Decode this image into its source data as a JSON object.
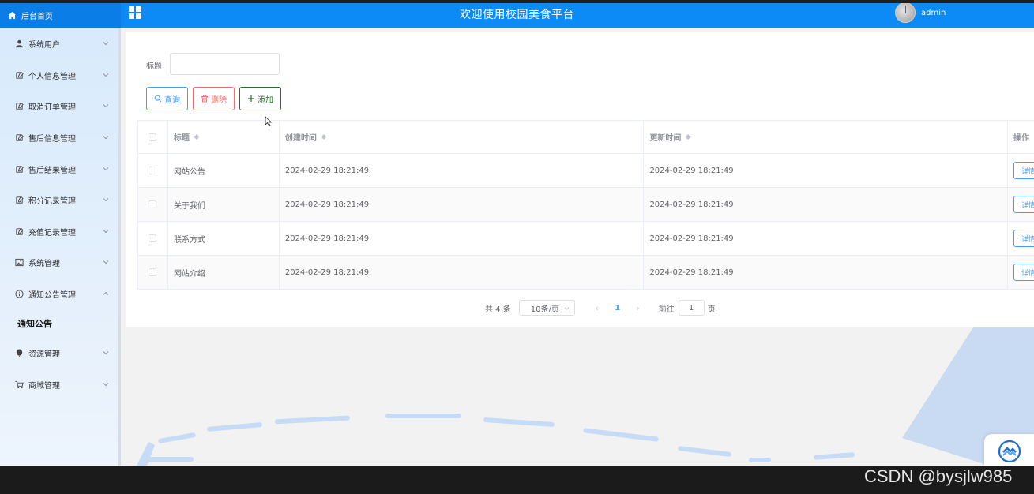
{
  "header": {
    "home_label": "后台首页",
    "title": "欢迎使用校园美食平台",
    "username": "admin"
  },
  "sidebar": {
    "items": [
      {
        "label": "系统用户",
        "icon": "user-icon"
      },
      {
        "label": "个人信息管理",
        "icon": "edit-icon"
      },
      {
        "label": "取消订单管理",
        "icon": "edit-icon"
      },
      {
        "label": "售后信息管理",
        "icon": "edit-icon"
      },
      {
        "label": "售后结果管理",
        "icon": "edit-icon"
      },
      {
        "label": "积分记录管理",
        "icon": "edit-icon"
      },
      {
        "label": "充值记录管理",
        "icon": "edit-icon"
      },
      {
        "label": "系统管理",
        "icon": "picture-icon"
      },
      {
        "label": "通知公告管理",
        "icon": "info-icon",
        "expanded": true
      },
      {
        "label": "资源管理",
        "icon": "balloon-icon"
      },
      {
        "label": "商城管理",
        "icon": "cart-icon"
      }
    ],
    "sub_items": [
      {
        "label": "通知公告",
        "active": true
      }
    ]
  },
  "filter": {
    "title_label": "标题",
    "title_value": "",
    "title_placeholder": ""
  },
  "toolbar": {
    "search_label": "查询",
    "delete_label": "删除",
    "add_label": "添加"
  },
  "table": {
    "headers": {
      "title": "标题",
      "created": "创建时间",
      "updated": "更新时间",
      "operation": "操作"
    },
    "detail_label": "详情",
    "rows": [
      {
        "title": "网站公告",
        "created": "2024-02-29 18:21:49",
        "updated": "2024-02-29 18:21:49"
      },
      {
        "title": "关于我们",
        "created": "2024-02-29 18:21:49",
        "updated": "2024-02-29 18:21:49"
      },
      {
        "title": "联系方式",
        "created": "2024-02-29 18:21:49",
        "updated": "2024-02-29 18:21:49"
      },
      {
        "title": "网站介绍",
        "created": "2024-02-29 18:21:49",
        "updated": "2024-02-29 18:21:49"
      }
    ]
  },
  "pagination": {
    "total": "共 4 条",
    "page_size": "10条/页",
    "current_page": "1",
    "goto_label": "前往",
    "goto_value": "1",
    "page_suffix": "页"
  },
  "watermark": "CSDN @bysjlw985",
  "colors": {
    "header_bg": "#0c8bf7",
    "primary": "#409eff",
    "danger": "#f56c6c",
    "success_dark": "#2d6a2d"
  }
}
